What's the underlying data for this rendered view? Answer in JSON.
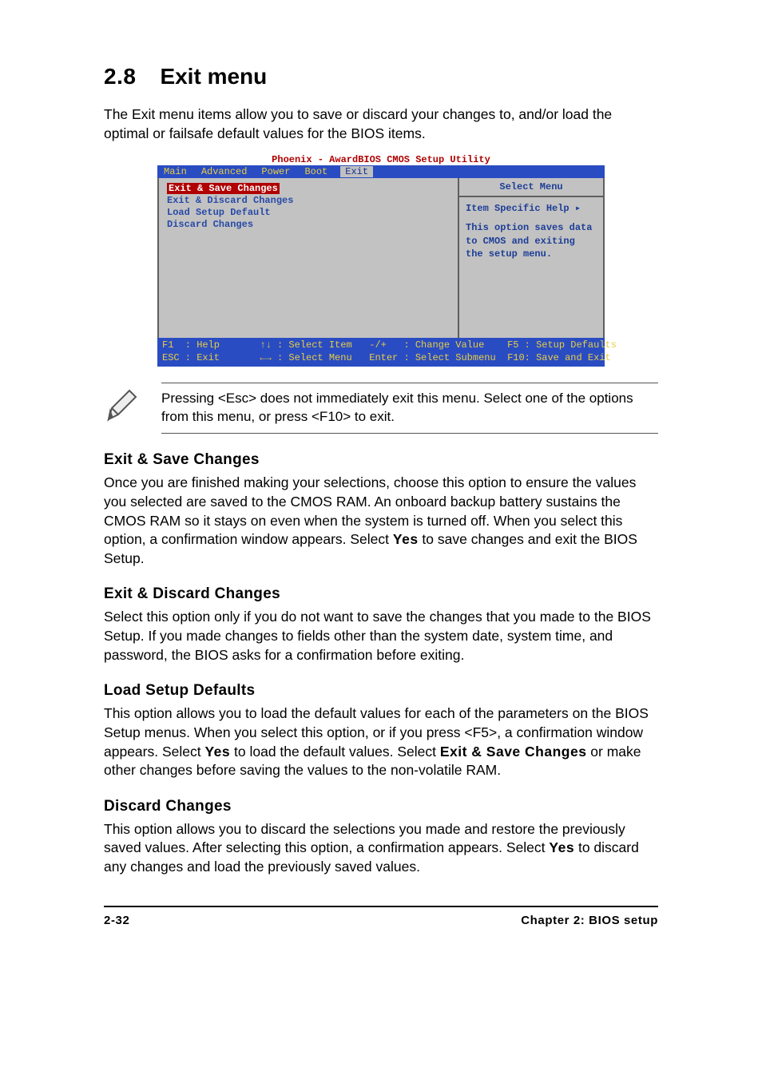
{
  "heading": {
    "number": "2.8",
    "title": "Exit menu"
  },
  "intro": "The Exit menu items allow you to save or discard your changes to, and/or load the optimal or failsafe default values for the BIOS items.",
  "bios": {
    "title": "Phoenix - AwardBIOS CMOS Setup Utility",
    "tabs": [
      "Main",
      "Advanced",
      "Power",
      "Boot",
      "Exit"
    ],
    "activeTab": "Exit",
    "menuItems": [
      "Exit & Save Changes",
      "Exit & Discard Changes",
      "Load Setup Default",
      "Discard Changes"
    ],
    "selectedItem": "Exit & Save Changes",
    "rightHeader": "Select Menu",
    "helpTitle": "Item Specific Help ▸",
    "helpBody": "This option saves data to CMOS and exiting the setup menu.",
    "footerLine1": "F1  : Help       ↑↓ : Select Item   -/+   : Change Value    F5 : Setup Defaults",
    "footerLine2": "ESC : Exit       ←→ : Select Menu   Enter : Select Submenu  F10: Save and Exit"
  },
  "note": "Pressing <Esc> does not immediately exit this menu. Select one of the options from this menu, or press <F10> to exit.",
  "sections": {
    "s1": {
      "title": "Exit & Save Changes",
      "p1a": "Once you are finished making your selections, choose this option to ensure the values you selected are saved to the CMOS RAM. An onboard backup battery sustains the CMOS RAM so it stays on even when the system is turned off. When you select this option, a confirmation window appears. Select ",
      "p1yes": "Yes",
      "p1b": " to save changes and exit the BIOS Setup."
    },
    "s2": {
      "title": "Exit & Discard Changes",
      "p": "Select this option only if you do not want to save the changes that you made to the BIOS Setup. If you made changes to fields other than the system date, system time, and password, the BIOS asks for a confirmation before exiting."
    },
    "s3": {
      "title": "Load Setup Defaults",
      "p1": "This option allows you to load the default values for each of the parameters on the BIOS Setup menus. When you select this option, or if you press <F5>, a confirmation window appears. Select ",
      "yes": "Yes",
      "p2": " to load the default values. Select ",
      "esc": "Exit & Save Changes",
      "p3": " or make other changes before saving the values to the non-volatile RAM."
    },
    "s4": {
      "title": "Discard Changes",
      "p1": "This option allows you to discard the selections you made and restore the previously saved values. After selecting this option, a confirmation appears. Select ",
      "yes": "Yes",
      "p2": " to discard any changes and load the previously saved values."
    }
  },
  "footer": {
    "left": "2-32",
    "right": "Chapter 2: BIOS setup"
  }
}
